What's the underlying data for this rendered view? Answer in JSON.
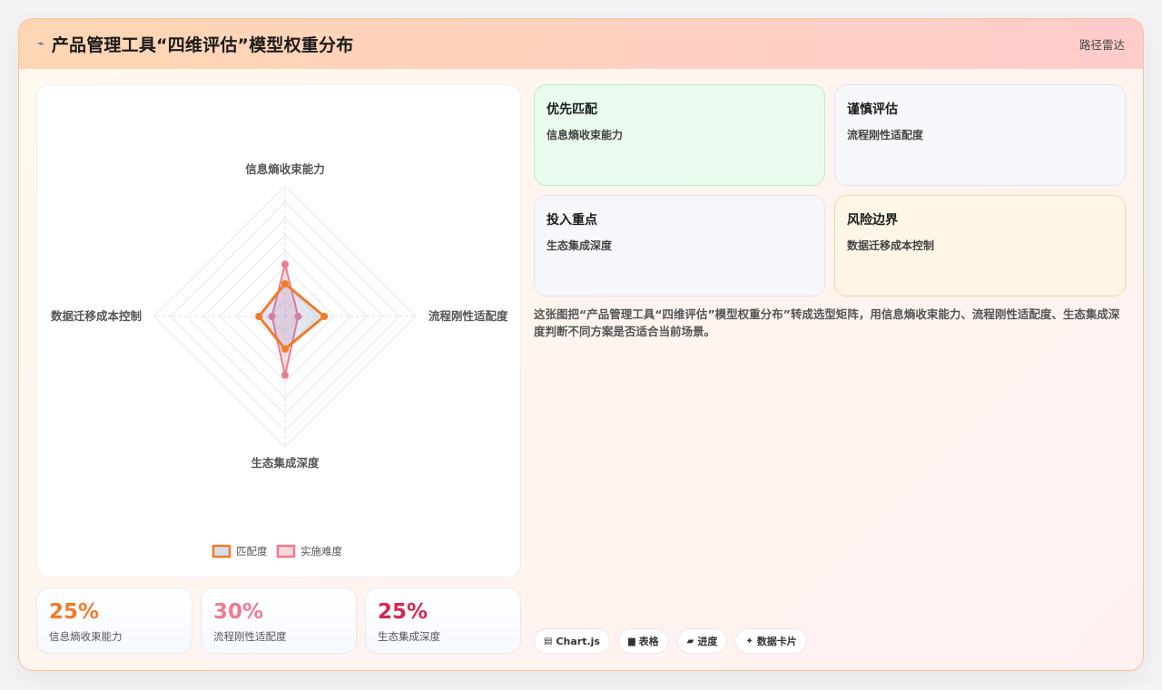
{
  "header": {
    "title": "产品管理工具“四维评估”模型权重分布",
    "tag": "路径雷达"
  },
  "chart_data": {
    "type": "radar",
    "axes": [
      "信息熵收束能力",
      "流程刚性适配度",
      "生态集成深度",
      "数据迁移成本控制"
    ],
    "rmax": 100,
    "rings": 8,
    "series": [
      {
        "name": "匹配度",
        "values": [
          25,
          30,
          25,
          20
        ],
        "color": "#f07b2a",
        "fill": "rgba(120,140,200,0.22)"
      },
      {
        "name": "实施难度",
        "values": [
          40,
          10,
          45,
          10
        ],
        "color": "#ee7a92",
        "fill": "rgba(238,122,146,0.22)"
      }
    ],
    "legend": "bottom"
  },
  "stats": [
    {
      "value": "25%",
      "label": "信息熵收束能力",
      "color": "#f07b2a"
    },
    {
      "value": "30%",
      "label": "流程刚性适配度",
      "color": "#ee7a92"
    },
    {
      "value": "25%",
      "label": "生态集成深度",
      "color": "#d6264f"
    }
  ],
  "quad": [
    {
      "title": "优先匹配",
      "sub": "信息熵收束能力"
    },
    {
      "title": "谨慎评估",
      "sub": "流程刚性适配度"
    },
    {
      "title": "投入重点",
      "sub": "生态集成深度"
    },
    {
      "title": "风险边界",
      "sub": "数据迁移成本控制"
    }
  ],
  "description": "这张图把“产品管理工具“四维评估”模型权重分布”转成选型矩阵，用信息熵收束能力、流程刚性适配度、生态集成深度判断不同方案是否适合当前场景。",
  "chips": [
    {
      "icon": "chart-icon",
      "glyph": "▤",
      "label": "Chart.js"
    },
    {
      "icon": "table-icon",
      "glyph": "▆",
      "label": "表格"
    },
    {
      "icon": "progress-icon",
      "glyph": "▰",
      "label": "进度"
    },
    {
      "icon": "card-icon",
      "glyph": "✦",
      "label": "数据卡片"
    }
  ]
}
